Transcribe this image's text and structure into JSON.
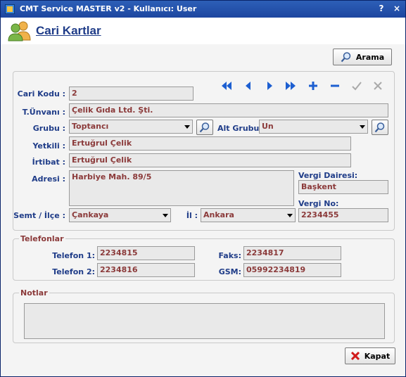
{
  "window": {
    "title": "CMT Service MASTER v2  -   Kullanıcı: User",
    "help_label": "?",
    "close_label": "×"
  },
  "header": {
    "title": "Cari Kartlar"
  },
  "search_button": {
    "label": "Arama",
    "icon": "magnifier-icon"
  },
  "navigation": {
    "icons": [
      "first-record-icon",
      "previous-record-icon",
      "next-record-icon",
      "last-record-icon",
      "add-icon",
      "remove-icon",
      "confirm-icon",
      "cancel-icon"
    ]
  },
  "form": {
    "cari_kodu": {
      "label": "Cari Kodu :",
      "value": "2"
    },
    "unvan": {
      "label": "T.Ünvanı :",
      "value": "Çelik Gıda Ltd. Şti."
    },
    "grubu": {
      "label": "Grubu :",
      "value": "Toptancı"
    },
    "alt_grubu": {
      "label": "Alt Grubu :",
      "value": "Un"
    },
    "yetkili": {
      "label": "Yetkili :",
      "value": "Ertuğrul Çelik"
    },
    "irtibat": {
      "label": "İrtibat :",
      "value": "Ertuğrul Çelik"
    },
    "adres": {
      "label": "Adresi :",
      "value": "Harbiye Mah. 89/5"
    },
    "vergi_dairesi": {
      "label": "Vergi Dairesi:",
      "value": "Başkent"
    },
    "vergi_no": {
      "label": "Vergi No:",
      "value": "2234455"
    },
    "semt": {
      "label": "Semt / İlçe :",
      "value": "Çankaya"
    },
    "il": {
      "label": "İl :",
      "value": "Ankara"
    }
  },
  "phones": {
    "legend": "Telefonlar",
    "telefon1": {
      "label": "Telefon 1:",
      "value": "2234815"
    },
    "telefon2": {
      "label": "Telefon 2:",
      "value": "2234816"
    },
    "faks": {
      "label": "Faks:",
      "value": "2234817"
    },
    "gsm": {
      "label": "GSM:",
      "value": "05992234819"
    }
  },
  "notes": {
    "legend": "Notlar",
    "value": ""
  },
  "close_button": {
    "label": "Kapat",
    "icon": "red-x-icon"
  },
  "colors": {
    "label_blue": "#1f3c88",
    "value_brown": "#8b3a3a",
    "nav_blue": "#1d5fd1",
    "titlebar": "#1d46a0"
  }
}
